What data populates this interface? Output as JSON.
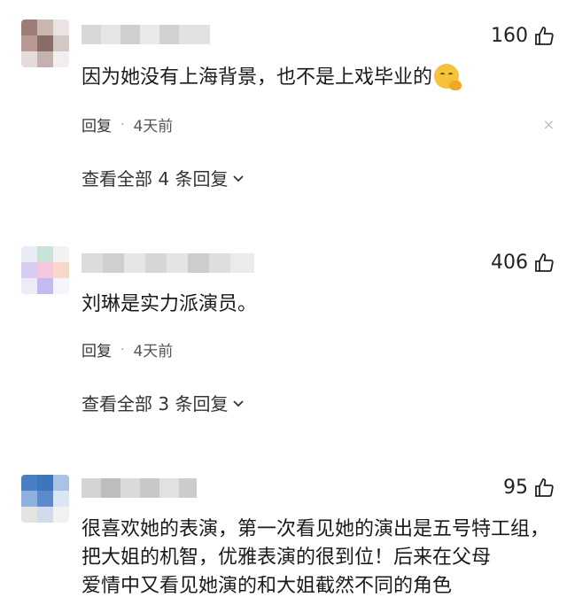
{
  "comments": [
    {
      "likes": "160",
      "text": "因为她没有上海背景，也不是上戏毕业的",
      "emoji": "smirk-emoji",
      "reply_label": "回复",
      "dot": "·",
      "time": "4天前",
      "close": "×",
      "view_replies": "查看全部 4 条回复"
    },
    {
      "likes": "406",
      "text": "刘琳是实力派演员。",
      "reply_label": "回复",
      "dot": "·",
      "time": "4天前",
      "view_replies": "查看全部 3 条回复"
    },
    {
      "likes": "95",
      "text": "很喜欢她的表演，第一次看见她的演出是五号特工组，把大姐的机智，优雅表演的很到位！后来在父母",
      "text_cut": "爱情中又看见她演的和大姐截然不同的角色"
    }
  ],
  "icons": {
    "like": "thumbs-up-icon",
    "chevron": "chevron-down-icon",
    "close": "close-icon"
  }
}
